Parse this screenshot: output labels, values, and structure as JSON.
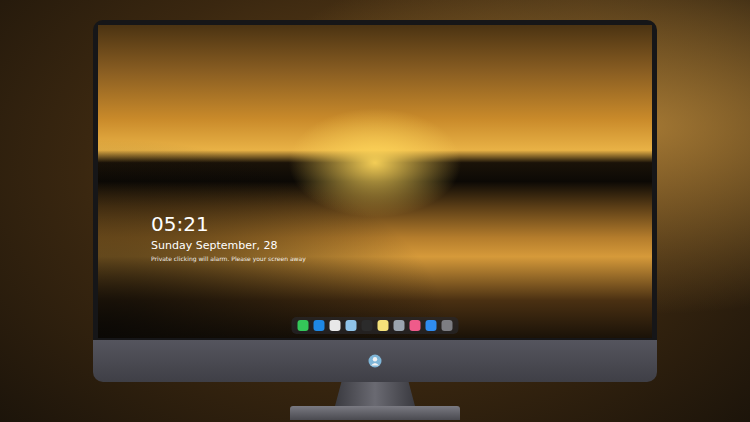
{
  "lock_screen": {
    "time": "05:21",
    "date": "Sunday September, 28",
    "notice": "Private clicking will alarm. Please your screen away"
  },
  "dock": {
    "apps": [
      {
        "color": "#34c759"
      },
      {
        "color": "#1e88e5"
      },
      {
        "color": "#e8e8e8"
      },
      {
        "color": "#8fc3e8"
      },
      {
        "color": "#2b2b2b"
      },
      {
        "color": "#f5e27a"
      },
      {
        "color": "#9aa4ae"
      },
      {
        "color": "#ef5b8a"
      },
      {
        "color": "#2f8cf0"
      },
      {
        "color": "#7d7d82"
      }
    ]
  }
}
